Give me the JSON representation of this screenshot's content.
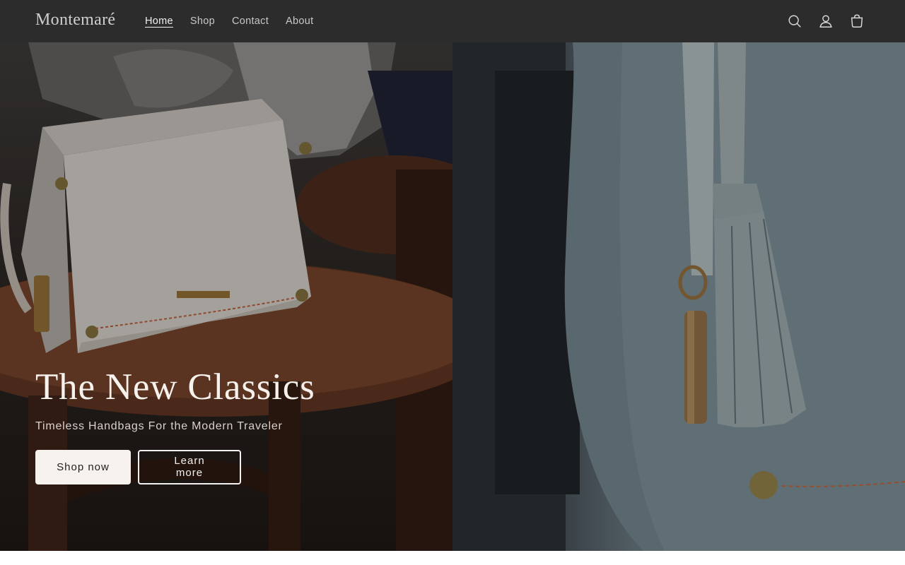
{
  "header": {
    "logo": "Montemaré",
    "nav": [
      {
        "label": "Home",
        "active": true
      },
      {
        "label": "Shop",
        "active": false
      },
      {
        "label": "Contact",
        "active": false
      },
      {
        "label": "About",
        "active": false
      }
    ],
    "icons": [
      "search-icon",
      "account-icon",
      "cart-icon"
    ]
  },
  "hero": {
    "title": "The New Classics",
    "subtitle": "Timeless Handbags For the Modern Traveler",
    "primary_button": "Shop now",
    "secondary_button": "Learn more",
    "left_image": "handbag-on-chair-image",
    "right_image": "handbag-tassel-closeup-image"
  },
  "colors": {
    "header_bg": "#2c2c2c",
    "accent_button": "#f7f2ee"
  }
}
